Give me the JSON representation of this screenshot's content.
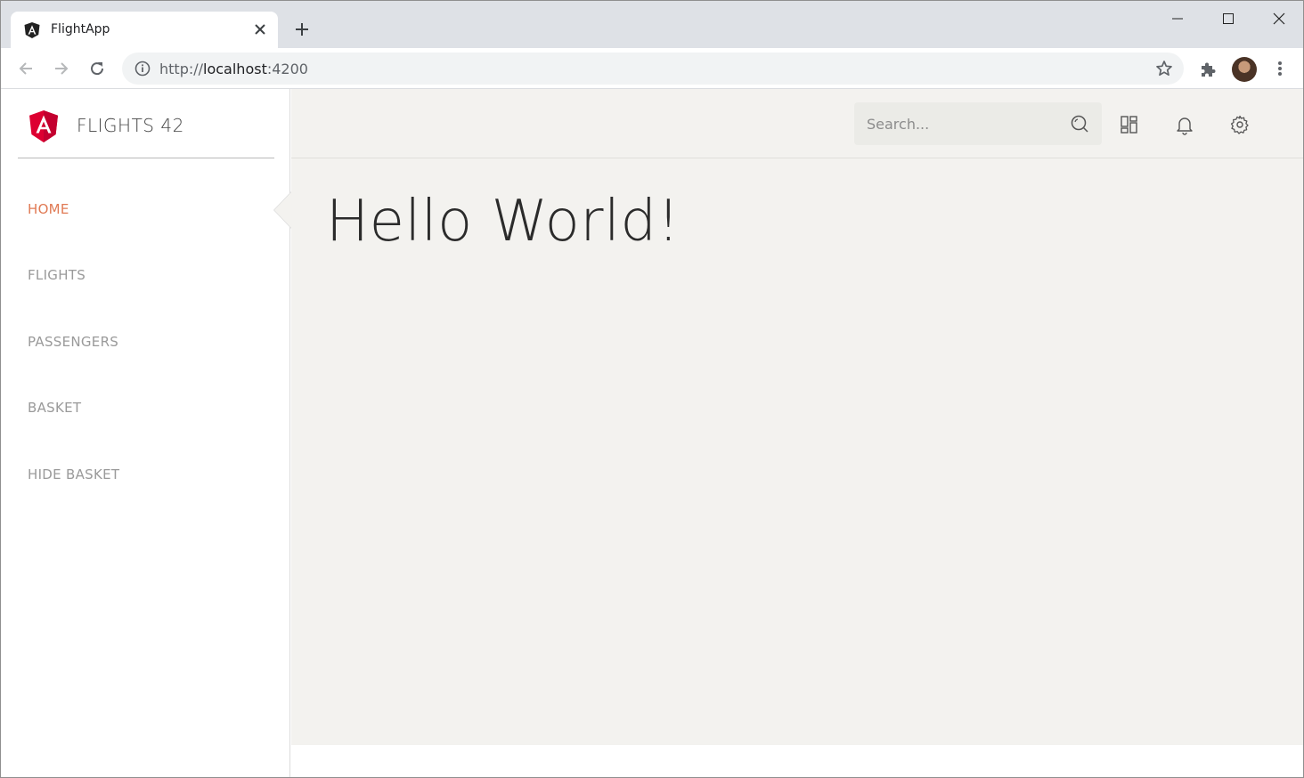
{
  "browser": {
    "tab_title": "FlightApp",
    "url_scheme": "http://",
    "url_host": "localhost",
    "url_rest": ":4200",
    "icons": {
      "favicon": "angular-logo-icon",
      "tab_close": "close-icon",
      "new_tab": "plus-icon",
      "minimize": "minimize-icon",
      "maximize": "maximize-icon",
      "close_window": "close-icon",
      "back": "arrow-left-icon",
      "forward": "arrow-right-icon",
      "reload": "reload-icon",
      "site_info": "info-icon",
      "bookmark": "star-icon",
      "extensions": "puzzle-icon",
      "profile": "avatar",
      "menu": "more-vert-icon"
    }
  },
  "sidebar": {
    "brand": "FLIGHTS 42",
    "items": [
      {
        "label": "HOME",
        "active": true
      },
      {
        "label": "FLIGHTS",
        "active": false
      },
      {
        "label": "PASSENGERS",
        "active": false
      },
      {
        "label": "BASKET",
        "active": false
      },
      {
        "label": "HIDE BASKET",
        "active": false
      }
    ]
  },
  "topbar": {
    "search_placeholder": "Search...",
    "icons": [
      "search-icon",
      "dashboard-icon",
      "bell-icon",
      "gear-icon"
    ]
  },
  "main": {
    "heading": "Hello World!"
  },
  "colors": {
    "accent": "#e07a54",
    "angular_red": "#dd0031",
    "content_bg": "#f3f2ef",
    "tab_strip": "#dee1e6"
  }
}
